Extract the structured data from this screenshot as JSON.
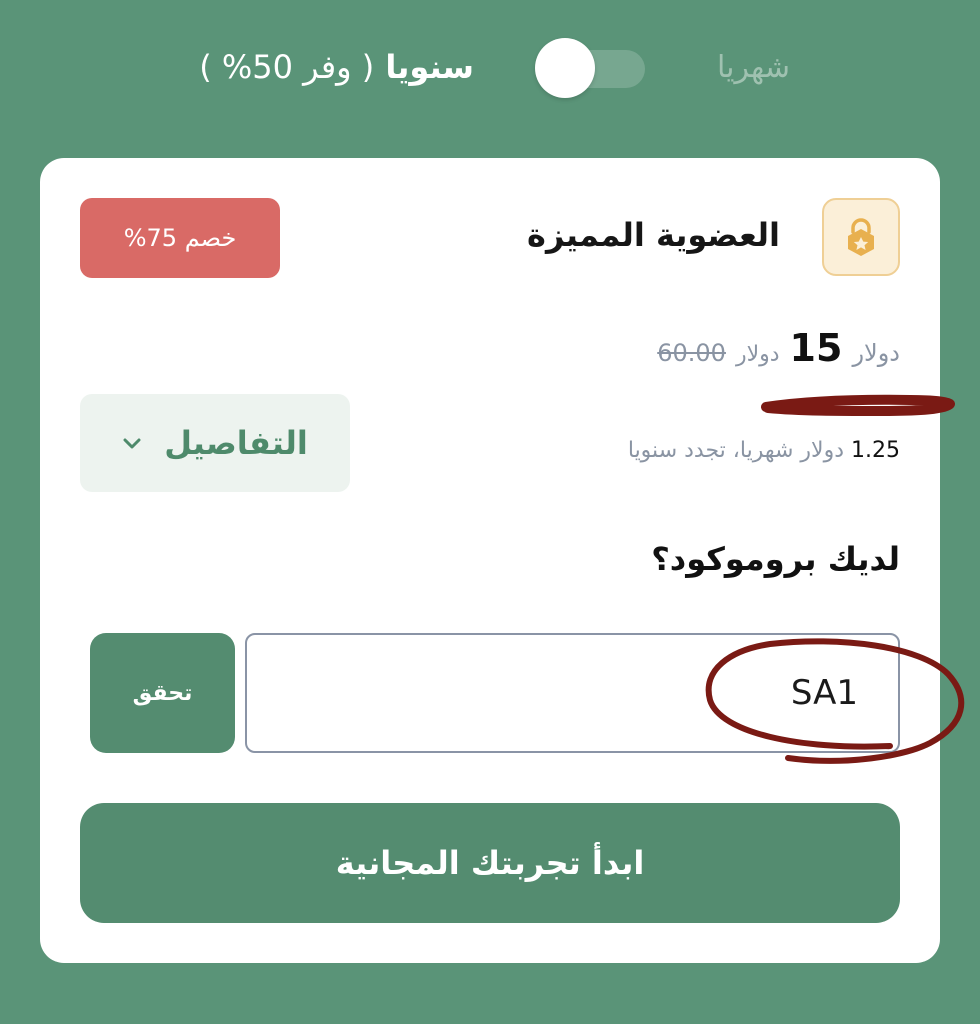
{
  "billing_toggle": {
    "yearly_label": "سنويا",
    "yearly_save": "( وفر 50% )",
    "monthly_label": "شهريا",
    "selected": "yearly"
  },
  "plan": {
    "icon": "crown-lock-icon",
    "title": "العضوية المميزة",
    "discount_badge": "خصم 75%",
    "price_currency": "دولار",
    "price": "15",
    "old_price_currency": "دولار",
    "old_price": "60.00",
    "monthly_amount": "1.25",
    "monthly_note": "دولار شهريا، تجدد سنويا",
    "details_label": "التفاصيل",
    "details_icon": "chevron-down-icon"
  },
  "promo": {
    "question": "لديك بروموكود؟",
    "code_value": "SA1",
    "verify_label": "تحقق"
  },
  "cta": {
    "label": "ابدأ تجربتك المجانية"
  },
  "colors": {
    "background": "#5a9478",
    "primary": "#548c70",
    "badge": "#d96a66",
    "icon_bg": "#fbefd8",
    "annotation": "#7a1a14"
  }
}
